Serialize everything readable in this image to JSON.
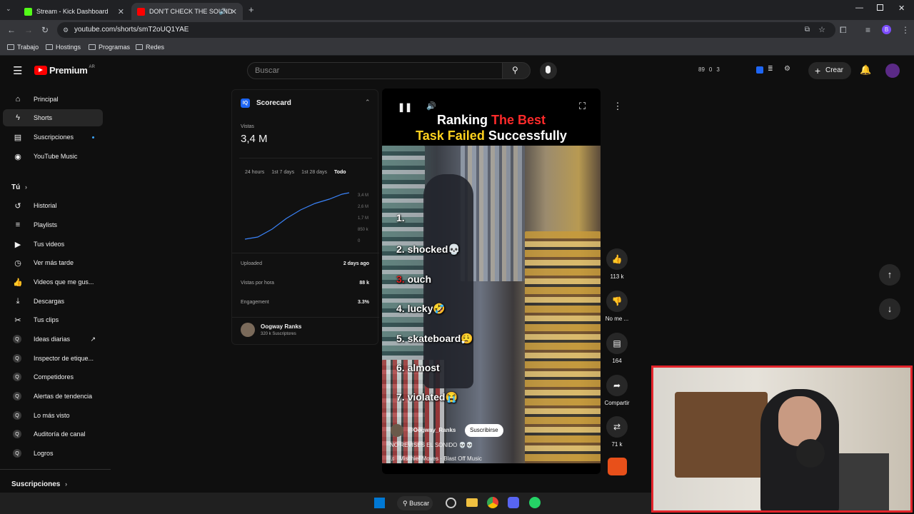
{
  "browser": {
    "tabs": [
      {
        "label": "Stream - Kick Dashboard",
        "active": false
      },
      {
        "label": "DON'T CHECK THE SOUND",
        "active": true
      }
    ],
    "url": "youtube.com/shorts/smT2oUQ1YAE",
    "bookmarks": [
      "Trabajo",
      "Hostings",
      "Programas",
      "Redes"
    ]
  },
  "header": {
    "logo": "Premium",
    "region": "AR",
    "search_placeholder": "Buscar",
    "stats": {
      "a": "89",
      "b": "0",
      "c": "3"
    },
    "create_label": "Crear"
  },
  "sidebar": {
    "main": [
      {
        "label": "Principal",
        "icon": "home-icon"
      },
      {
        "label": "Shorts",
        "icon": "shorts-icon"
      },
      {
        "label": "Suscripciones",
        "icon": "subscriptions-icon"
      },
      {
        "label": "YouTube Music",
        "icon": "music-icon"
      }
    ],
    "you_label": "Tú",
    "you": [
      {
        "label": "Historial",
        "icon": "history-icon"
      },
      {
        "label": "Playlists",
        "icon": "playlist-icon"
      },
      {
        "label": "Tus videos",
        "icon": "video-icon"
      },
      {
        "label": "Ver más tarde",
        "icon": "clock-icon"
      },
      {
        "label": "Videos que me gus...",
        "icon": "like-icon"
      },
      {
        "label": "Descargas",
        "icon": "download-icon"
      },
      {
        "label": "Tus clips",
        "icon": "scissors-icon"
      },
      {
        "label": "Ideas diarias",
        "icon": "vidiq-icon"
      },
      {
        "label": "Inspector de etique...",
        "icon": "vidiq-icon"
      },
      {
        "label": "Competidores",
        "icon": "vidiq-icon"
      },
      {
        "label": "Alertas de tendencia",
        "icon": "vidiq-icon"
      },
      {
        "label": "Lo más visto",
        "icon": "vidiq-icon"
      },
      {
        "label": "Auditoría de canal",
        "icon": "vidiq-icon"
      },
      {
        "label": "Logros",
        "icon": "vidiq-icon"
      }
    ],
    "subscriptions_label": "Suscripciones"
  },
  "scorecard": {
    "title": "Scorecard",
    "views_label": "Vistas",
    "views_value": "3,4 M",
    "ranges": [
      "24 hours",
      "1st 7 days",
      "1st 28 days",
      "Todo"
    ],
    "y_ticks": [
      "3,4 M",
      "2,6 M",
      "1,7 M",
      "850 k",
      "0"
    ],
    "uploaded_label": "Uploaded",
    "uploaded_value": "2 days ago",
    "vph_label": "Vistas por hora",
    "vph_value": "88 k",
    "engagement_label": "Engagement",
    "engagement_value": "3.3%",
    "channel_name": "Oogway Ranks",
    "channel_subs": "320 k Suscriptores"
  },
  "video": {
    "title_line1_a": "Ranking ",
    "title_line1_b": "The Best",
    "title_line2_a": "Task Failed ",
    "title_line2_b": "Successfully",
    "ranks": [
      {
        "n": "1.",
        "text": ""
      },
      {
        "n": "2.",
        "text": "shocked💀"
      },
      {
        "n": "3.",
        "text": "ouch"
      },
      {
        "n": "4.",
        "text": "lucky🤣"
      },
      {
        "n": "5.",
        "text": "skateboard😮‍💨"
      },
      {
        "n": "6.",
        "text": "almost"
      },
      {
        "n": "7.",
        "text": "violated😭"
      }
    ],
    "channel": "@Oogway_Ranks",
    "subscribe": "Suscribirse",
    "caption": "NO REVISES EL SONIDO 💀💀",
    "music": "Mischief Moves · Blast Off Music"
  },
  "actions": {
    "likes": "113 k",
    "dislike": "No me ...",
    "comments": "164",
    "share": "Compartir",
    "remix": "71 k"
  },
  "taskbar": {
    "search": "Buscar"
  }
}
